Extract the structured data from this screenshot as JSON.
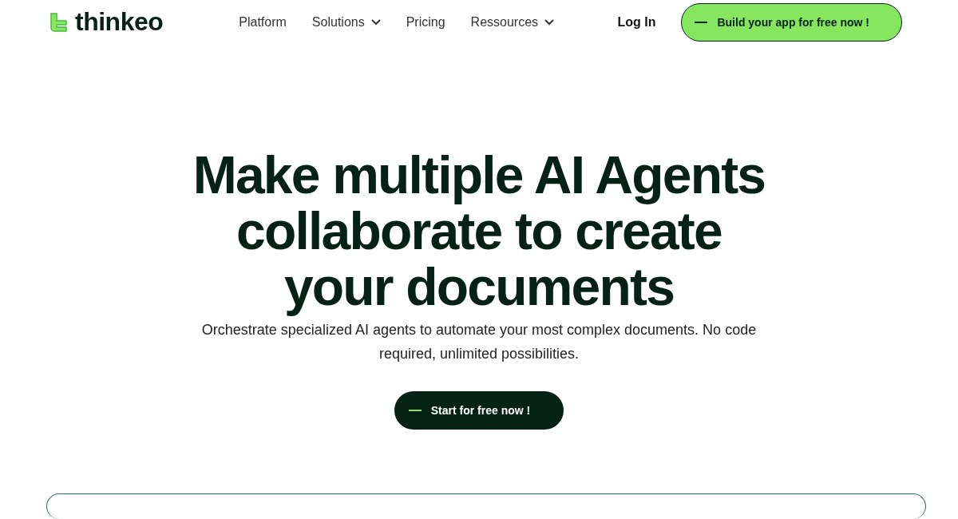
{
  "logo": {
    "text": "thinkeo"
  },
  "nav": [
    {
      "label": "Platform",
      "dropdown": false
    },
    {
      "label": "Solutions",
      "dropdown": true
    },
    {
      "label": "Pricing",
      "dropdown": false
    },
    {
      "label": "Ressources",
      "dropdown": true
    }
  ],
  "login": "Log In",
  "cta": "Build your app for free now !",
  "hero": {
    "title": "Make multiple AI Agents collaborate to create your documents",
    "subtitle": "Orchestrate specialized AI agents to automate your most complex documents. No code required, unlimited possibilities.",
    "button": "Start for free now !"
  }
}
